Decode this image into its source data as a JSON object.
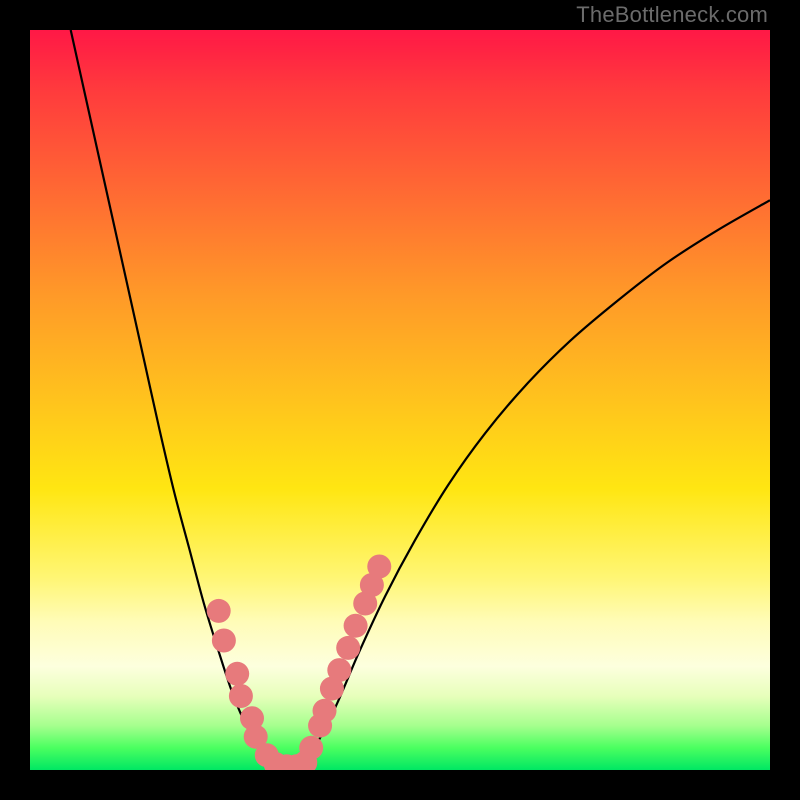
{
  "watermark": "TheBottleneck.com",
  "colors": {
    "frame": "#000000",
    "curve_stroke": "#000000",
    "scatter_fill": "#e77a7c",
    "gradient_stops": [
      {
        "pct": 0,
        "hex": "#ff1846"
      },
      {
        "pct": 8,
        "hex": "#ff3a3d"
      },
      {
        "pct": 22,
        "hex": "#ff6a33"
      },
      {
        "pct": 36,
        "hex": "#ff9a28"
      },
      {
        "pct": 50,
        "hex": "#ffc31d"
      },
      {
        "pct": 62,
        "hex": "#ffe612"
      },
      {
        "pct": 74,
        "hex": "#fff674"
      },
      {
        "pct": 80,
        "hex": "#fffcb8"
      },
      {
        "pct": 86,
        "hex": "#fdffde"
      },
      {
        "pct": 90,
        "hex": "#e7ffbb"
      },
      {
        "pct": 94,
        "hex": "#a6ff8e"
      },
      {
        "pct": 97,
        "hex": "#4bff60"
      },
      {
        "pct": 100,
        "hex": "#00e763"
      }
    ]
  },
  "chart_data": {
    "type": "line",
    "title": "",
    "xlabel": "",
    "ylabel": "",
    "xlim": [
      0,
      1
    ],
    "ylim": [
      0,
      1
    ],
    "grid": false,
    "legend": false,
    "series": [
      {
        "name": "bottleneck-curve",
        "role": "line",
        "points": [
          {
            "x": 0.055,
            "y": 1.0
          },
          {
            "x": 0.075,
            "y": 0.91
          },
          {
            "x": 0.095,
            "y": 0.82
          },
          {
            "x": 0.115,
            "y": 0.73
          },
          {
            "x": 0.135,
            "y": 0.64
          },
          {
            "x": 0.155,
            "y": 0.55
          },
          {
            "x": 0.175,
            "y": 0.46
          },
          {
            "x": 0.195,
            "y": 0.375
          },
          {
            "x": 0.215,
            "y": 0.3
          },
          {
            "x": 0.235,
            "y": 0.225
          },
          {
            "x": 0.255,
            "y": 0.16
          },
          {
            "x": 0.275,
            "y": 0.1
          },
          {
            "x": 0.295,
            "y": 0.055
          },
          {
            "x": 0.315,
            "y": 0.025
          },
          {
            "x": 0.335,
            "y": 0.008
          },
          {
            "x": 0.35,
            "y": 0.004
          },
          {
            "x": 0.37,
            "y": 0.012
          },
          {
            "x": 0.39,
            "y": 0.04
          },
          {
            "x": 0.415,
            "y": 0.09
          },
          {
            "x": 0.445,
            "y": 0.16
          },
          {
            "x": 0.48,
            "y": 0.235
          },
          {
            "x": 0.52,
            "y": 0.31
          },
          {
            "x": 0.565,
            "y": 0.385
          },
          {
            "x": 0.615,
            "y": 0.455
          },
          {
            "x": 0.67,
            "y": 0.52
          },
          {
            "x": 0.73,
            "y": 0.58
          },
          {
            "x": 0.795,
            "y": 0.635
          },
          {
            "x": 0.86,
            "y": 0.685
          },
          {
            "x": 0.93,
            "y": 0.73
          },
          {
            "x": 1.0,
            "y": 0.77
          }
        ]
      },
      {
        "name": "scatter-markers",
        "role": "scatter",
        "points": [
          {
            "x": 0.255,
            "y": 0.215
          },
          {
            "x": 0.262,
            "y": 0.175
          },
          {
            "x": 0.28,
            "y": 0.13
          },
          {
            "x": 0.285,
            "y": 0.1
          },
          {
            "x": 0.3,
            "y": 0.07
          },
          {
            "x": 0.305,
            "y": 0.045
          },
          {
            "x": 0.32,
            "y": 0.02
          },
          {
            "x": 0.332,
            "y": 0.008
          },
          {
            "x": 0.347,
            "y": 0.005
          },
          {
            "x": 0.36,
            "y": 0.005
          },
          {
            "x": 0.372,
            "y": 0.01
          },
          {
            "x": 0.38,
            "y": 0.03
          },
          {
            "x": 0.392,
            "y": 0.06
          },
          {
            "x": 0.398,
            "y": 0.08
          },
          {
            "x": 0.408,
            "y": 0.11
          },
          {
            "x": 0.418,
            "y": 0.135
          },
          {
            "x": 0.43,
            "y": 0.165
          },
          {
            "x": 0.44,
            "y": 0.195
          },
          {
            "x": 0.453,
            "y": 0.225
          },
          {
            "x": 0.462,
            "y": 0.25
          },
          {
            "x": 0.472,
            "y": 0.275
          }
        ]
      }
    ]
  }
}
